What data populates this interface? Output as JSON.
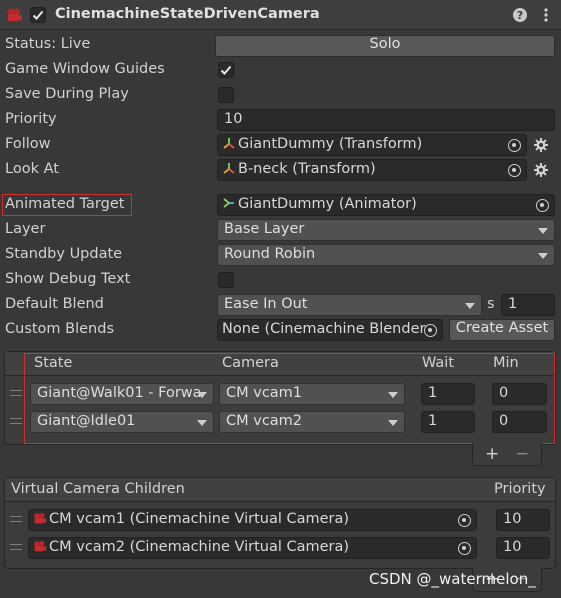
{
  "header": {
    "title": "CinemachineStateDrivenCamera",
    "enabled": true
  },
  "status": {
    "label": "Status: Live",
    "button": "Solo"
  },
  "game_window_guides": {
    "label": "Game Window Guides",
    "checked": true
  },
  "save_during_play": {
    "label": "Save During Play",
    "checked": false
  },
  "priority": {
    "label": "Priority",
    "value": "10"
  },
  "follow": {
    "label": "Follow",
    "value": "GiantDummy (Transform)"
  },
  "look_at": {
    "label": "Look At",
    "value": "B-neck (Transform)"
  },
  "animated_target": {
    "label": "Animated Target",
    "value": "GiantDummy (Animator)"
  },
  "layer": {
    "label": "Layer",
    "value": "Base Layer"
  },
  "standby_update": {
    "label": "Standby Update",
    "value": "Round Robin"
  },
  "show_debug_text": {
    "label": "Show Debug Text",
    "checked": false
  },
  "default_blend": {
    "label": "Default Blend",
    "value": "Ease In Out",
    "unit": "s",
    "time": "1"
  },
  "custom_blends": {
    "label": "Custom Blends",
    "value": "None (Cinemachine Blender",
    "button": "Create Asset"
  },
  "instructions": {
    "headers": {
      "state": "State",
      "camera": "Camera",
      "wait": "Wait",
      "min": "Min"
    },
    "rows": [
      {
        "state": "Giant@Walk01 - Forwa",
        "camera": "CM vcam1",
        "wait": "1",
        "min": "0"
      },
      {
        "state": "Giant@Idle01",
        "camera": "CM vcam2",
        "wait": "1",
        "min": "0"
      }
    ],
    "add": "+",
    "remove": "−"
  },
  "children": {
    "title": "Virtual Camera Children",
    "priority_header": "Priority",
    "rows": [
      {
        "name": "CM vcam1 (Cinemachine Virtual Camera)",
        "priority": "10"
      },
      {
        "name": "CM vcam2 (Cinemachine Virtual Camera)",
        "priority": "10"
      }
    ],
    "add": "+",
    "remove": "−"
  },
  "watermark": "CSDN @_watermelon_",
  "colors": {
    "highlight": "#d0302c",
    "background": "#383838",
    "field": "#2a2a2a",
    "dropdown": "#515151"
  }
}
